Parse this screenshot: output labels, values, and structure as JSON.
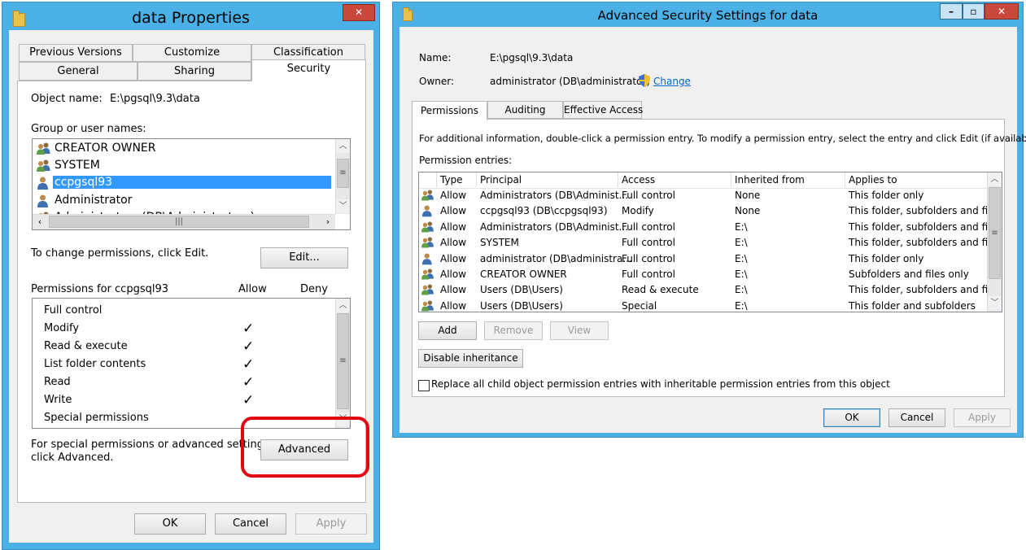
{
  "left": {
    "title": "data Properties",
    "tabs_row1": [
      "Previous Versions",
      "Customize",
      "Classification"
    ],
    "tabs_row2": [
      "General",
      "Sharing",
      "Security"
    ],
    "object_name_label": "Object name:",
    "object_name_value": "E:\\pgsql\\9.3\\data",
    "group_label": "Group or user names:",
    "users": [
      {
        "name": "CREATOR OWNER",
        "icon": "group-icon"
      },
      {
        "name": "SYSTEM",
        "icon": "group-icon"
      },
      {
        "name": "ccpgsql93",
        "icon": "user-icon",
        "selected": true
      },
      {
        "name": "Administrator",
        "icon": "user-icon"
      },
      {
        "name": "Administrators (DB\\Administrators)",
        "icon": "group-icon"
      }
    ],
    "change_text": "To change permissions, click Edit.",
    "edit_label": "Edit...",
    "permissions_for": "Permissions for ccpgsql93",
    "allow_header": "Allow",
    "deny_header": "Deny",
    "permissions": [
      {
        "name": "Full control",
        "allow": false
      },
      {
        "name": "Modify",
        "allow": true
      },
      {
        "name": "Read & execute",
        "allow": true
      },
      {
        "name": "List folder contents",
        "allow": true
      },
      {
        "name": "Read",
        "allow": true
      },
      {
        "name": "Write",
        "allow": true
      },
      {
        "name": "Special permissions",
        "allow": false
      }
    ],
    "special_text_1": "For special permissions or advanced settings,",
    "special_text_2": "click Advanced.",
    "advanced_label": "Advanced",
    "ok_label": "OK",
    "cancel_label": "Cancel",
    "apply_label": "Apply",
    "close_glyph": "✕",
    "highlight_color": "#e30613"
  },
  "right": {
    "title": "Advanced Security Settings for data",
    "name_label": "Name:",
    "name_value": "E:\\pgsql\\9.3\\data",
    "owner_label": "Owner:",
    "owner_value": "administrator (DB\\administrator)",
    "change_label": "Change",
    "tabs": [
      "Permissions",
      "Auditing",
      "Effective Access"
    ],
    "info_text": "For additional information, double-click a permission entry. To modify a permission entry, select the entry and click Edit (if available).",
    "entries_label": "Permission entries:",
    "columns": [
      "Type",
      "Principal",
      "Access",
      "Inherited from",
      "Applies to"
    ],
    "rows": [
      {
        "icon": "group-icon",
        "type": "Allow",
        "principal": "Administrators (DB\\Administ...",
        "access": "Full control",
        "inherited": "None",
        "applies": "This folder only"
      },
      {
        "icon": "user-icon",
        "type": "Allow",
        "principal": "ccpgsql93 (DB\\ccpgsql93)",
        "access": "Modify",
        "inherited": "None",
        "applies": "This folder, subfolders and files"
      },
      {
        "icon": "group-icon",
        "type": "Allow",
        "principal": "Administrators (DB\\Administ...",
        "access": "Full control",
        "inherited": "E:\\",
        "applies": "This folder, subfolders and files"
      },
      {
        "icon": "group-icon",
        "type": "Allow",
        "principal": "SYSTEM",
        "access": "Full control",
        "inherited": "E:\\",
        "applies": "This folder, subfolders and files"
      },
      {
        "icon": "user-icon",
        "type": "Allow",
        "principal": "administrator (DB\\administra...",
        "access": "Full control",
        "inherited": "E:\\",
        "applies": "This folder only"
      },
      {
        "icon": "group-icon",
        "type": "Allow",
        "principal": "CREATOR OWNER",
        "access": "Full control",
        "inherited": "E:\\",
        "applies": "Subfolders and files only"
      },
      {
        "icon": "group-icon",
        "type": "Allow",
        "principal": "Users (DB\\Users)",
        "access": "Read & execute",
        "inherited": "E:\\",
        "applies": "This folder, subfolders and files"
      },
      {
        "icon": "group-icon",
        "type": "Allow",
        "principal": "Users (DB\\Users)",
        "access": "Special",
        "inherited": "E:\\",
        "applies": "This folder and subfolders"
      }
    ],
    "add_label": "Add",
    "remove_label": "Remove",
    "view_label": "View",
    "disable_label": "Disable inheritance",
    "replace_text": "Replace all child object permission entries with inheritable permission entries from this object",
    "ok_label": "OK",
    "cancel_label": "Cancel",
    "apply_label": "Apply",
    "min_glyph": "–",
    "max_glyph": "▫",
    "close_glyph": "✕"
  }
}
